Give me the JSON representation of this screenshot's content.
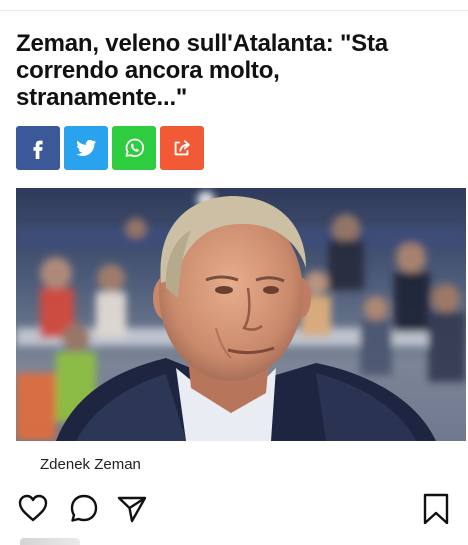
{
  "article": {
    "headline": "Zeman, veleno sull'Atalanta: \"Sta correndo ancora molto, stranamente...\"",
    "photo_caption": "Zdenek Zeman"
  },
  "share": {
    "buttons": [
      {
        "network": "facebook",
        "icon": "facebook-icon",
        "color": "#3b5998"
      },
      {
        "network": "twitter",
        "icon": "twitter-icon",
        "color": "#2aa3ef"
      },
      {
        "network": "whatsapp",
        "icon": "whatsapp-icon",
        "color": "#2ecc3f"
      },
      {
        "network": "share",
        "icon": "share-arrow-icon",
        "color": "#f25a36"
      }
    ]
  },
  "actions": {
    "icons": [
      "heart-icon",
      "comment-icon",
      "send-icon",
      "bookmark-icon"
    ]
  }
}
